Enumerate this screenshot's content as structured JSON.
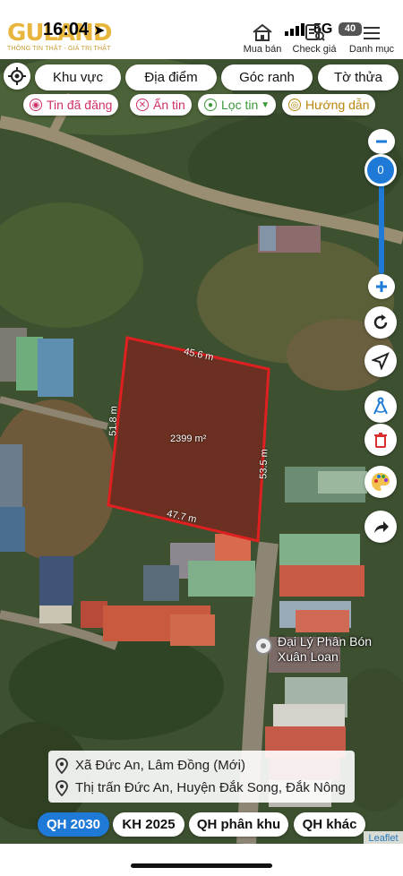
{
  "status_bar": {
    "time": "16:04",
    "network": "5G",
    "battery": "40"
  },
  "header": {
    "logo_text": "GULAND",
    "logo_tagline": "THÔNG TIN THẬT - GIÁ TRỊ THẬT",
    "buttons": [
      {
        "label": "Mua bán",
        "icon": "house-icon"
      },
      {
        "label": "Check giá",
        "icon": "price-check-icon"
      },
      {
        "label": "Danh mục",
        "icon": "menu-icon"
      }
    ]
  },
  "filters": {
    "row1": [
      "Khu vực",
      "Địa điểm",
      "Góc ranh",
      "Tờ thửa"
    ],
    "row2": [
      {
        "label": "Tin đã đăng",
        "color": "#d0306a"
      },
      {
        "label": "Ẩn tin",
        "color": "#d0306a"
      },
      {
        "label": "Lọc tin",
        "color": "#3a9a3a"
      },
      {
        "label": "Hướng dẫn",
        "color": "#b8860b"
      }
    ]
  },
  "zoom": {
    "level": "0"
  },
  "lot": {
    "area": "2399 m²",
    "edge_top": "45.6 m",
    "edge_left": "51.8 m",
    "edge_right": "53.5 m",
    "edge_bottom": "47.7 m",
    "outline_color": "#e02020"
  },
  "poi": {
    "name_line1": "Đại Lý Phân Bón",
    "name_line2": "Xuân Loan"
  },
  "address": {
    "line1": "Xã Đức An, Lâm Đồng (Mới)",
    "line2": "Thị trấn Đức An, Huyện Đắk Song, Đắk Nông"
  },
  "plan_tabs": [
    {
      "label": "QH 2030",
      "active": true
    },
    {
      "label": "KH 2025",
      "active": false
    },
    {
      "label": "QH phân khu",
      "active": false
    },
    {
      "label": "QH khác",
      "active": false
    }
  ],
  "attribution": "Leaflet",
  "colors": {
    "accent_blue": "#1e7ad6",
    "logo_gold": "#e8b63c"
  }
}
